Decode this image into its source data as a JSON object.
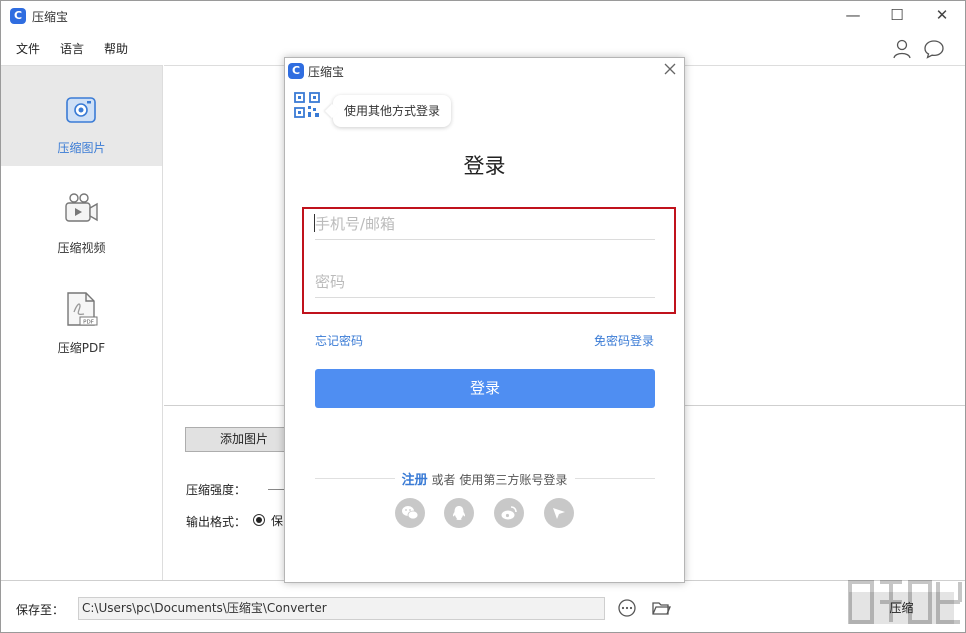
{
  "app": {
    "logo_glyph": "C",
    "title": "压缩宝"
  },
  "window_controls": {
    "minimize": "—",
    "maximize": "☐",
    "close": "✕"
  },
  "menu": [
    "文件",
    "语言",
    "帮助"
  ],
  "sidebar": {
    "items": [
      {
        "label": "压缩图片",
        "icon": "image-compress-icon",
        "active": true
      },
      {
        "label": "压缩视频",
        "icon": "video-compress-icon",
        "active": false
      },
      {
        "label": "压缩PDF",
        "icon": "pdf-compress-icon",
        "active": false
      }
    ]
  },
  "main": {
    "add_button": "添加图片",
    "strength_label": "压缩强度：",
    "format_label": "输出格式：",
    "format_option": "保"
  },
  "footer": {
    "save_label": "保存至：",
    "path": "C:\\Users\\pc\\Documents\\压缩宝\\Converter",
    "compress_button": "压缩"
  },
  "dialog": {
    "logo_glyph": "C",
    "title": "压缩宝",
    "other_login_tip": "使用其他方式登录",
    "heading": "登录",
    "phone_placeholder": "手机号/邮箱",
    "password_placeholder": "密码",
    "forgot_password": "忘记密码",
    "passwordless_login": "免密码登录",
    "login_button": "登录",
    "register": "注册",
    "or_text": "或者 使用第三方账号登录",
    "social": [
      "wechat-icon",
      "qq-icon",
      "weibo-icon",
      "other-icon"
    ]
  },
  "colors": {
    "accent": "#3a7bd5",
    "button_blue": "#4f8ef2",
    "highlight_red": "#c0121c"
  }
}
